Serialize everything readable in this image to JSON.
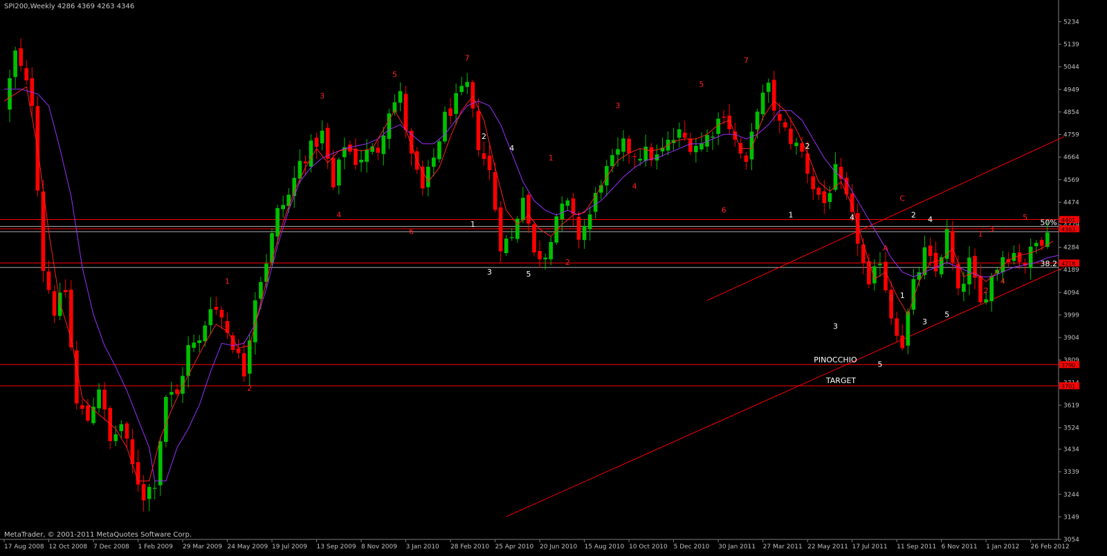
{
  "window": {
    "title": "SPI200,Weekly",
    "ohlc": "4286 4369 4263 4346",
    "copyright": "MetaTrader, © 2001-2011 MetaQuotes Software Corp."
  },
  "colors": {
    "background": "#000000",
    "bull": "#00c000",
    "bear": "#ff0000",
    "ma_fast": "#ff2020",
    "ma_slow": "#9b30ff",
    "level_line": "#ff0000",
    "fib_line": "#b0b0b0",
    "axis_text": "#c0c0c0",
    "wave_red": "#ff2020",
    "wave_white": "#ffffff"
  },
  "chart_data": {
    "type": "candlestick",
    "symbol": "SPI200",
    "timeframe": "Weekly",
    "ylim": [
      3054,
      5273
    ],
    "y_ticks": [
      5234,
      5139,
      5044,
      4949,
      4854,
      4759,
      4664,
      4569,
      4474,
      4379,
      4284,
      4189,
      4094,
      3999,
      3904,
      3809,
      3714,
      3619,
      3524,
      3434,
      3339,
      3244,
      3149,
      3054
    ],
    "x_ticks": [
      {
        "w": 0,
        "label": "17 Aug 2008"
      },
      {
        "w": 8,
        "label": "12 Oct 2008"
      },
      {
        "w": 16,
        "label": "7 Dec 2008"
      },
      {
        "w": 24,
        "label": "1 Feb 2009"
      },
      {
        "w": 32,
        "label": "29 Mar 2009"
      },
      {
        "w": 40,
        "label": "24 May 2009"
      },
      {
        "w": 48,
        "label": "19 Jul 2009"
      },
      {
        "w": 56,
        "label": "13 Sep 2009"
      },
      {
        "w": 64,
        "label": "8 Nov 2009"
      },
      {
        "w": 72,
        "label": "3 Jan 2010"
      },
      {
        "w": 80,
        "label": "28 Feb 2010"
      },
      {
        "w": 88,
        "label": "25 Apr 2010"
      },
      {
        "w": 96,
        "label": "20 Jun 2010"
      },
      {
        "w": 104,
        "label": "15 Aug 2010"
      },
      {
        "w": 112,
        "label": "10 Oct 2010"
      },
      {
        "w": 120,
        "label": "5 Dec 2010"
      },
      {
        "w": 128,
        "label": "30 Jan 2011"
      },
      {
        "w": 136,
        "label": "27 Mar 2011"
      },
      {
        "w": 144,
        "label": "22 May 2011"
      },
      {
        "w": 152,
        "label": "17 Jul 2011"
      },
      {
        "w": 160,
        "label": "11 Sep 2011"
      },
      {
        "w": 168,
        "label": "6 Nov 2011"
      },
      {
        "w": 176,
        "label": "1 Jan 2012"
      },
      {
        "w": 184,
        "label": "26 Feb 2012"
      }
    ],
    "close_path": [
      [
        0,
        4870
      ],
      [
        2,
        5100
      ],
      [
        5,
        4900
      ],
      [
        7,
        4200
      ],
      [
        9,
        4020
      ],
      [
        11,
        4100
      ],
      [
        13,
        3620
      ],
      [
        15,
        3560
      ],
      [
        17,
        3700
      ],
      [
        19,
        3460
      ],
      [
        21,
        3540
      ],
      [
        23,
        3360
      ],
      [
        25,
        3240
      ],
      [
        27,
        3300
      ],
      [
        29,
        3660
      ],
      [
        31,
        3660
      ],
      [
        33,
        3860
      ],
      [
        35,
        3880
      ],
      [
        37,
        4050
      ],
      [
        39,
        3990
      ],
      [
        41,
        3880
      ],
      [
        43,
        3760
      ],
      [
        45,
        4080
      ],
      [
        47,
        4230
      ],
      [
        49,
        4430
      ],
      [
        51,
        4500
      ],
      [
        53,
        4640
      ],
      [
        55,
        4700
      ],
      [
        57,
        4760
      ],
      [
        59,
        4530
      ],
      [
        61,
        4720
      ],
      [
        63,
        4650
      ],
      [
        65,
        4680
      ],
      [
        67,
        4700
      ],
      [
        69,
        4870
      ],
      [
        71,
        4920
      ],
      [
        73,
        4660
      ],
      [
        75,
        4520
      ],
      [
        77,
        4660
      ],
      [
        79,
        4830
      ],
      [
        81,
        4900
      ],
      [
        83,
        4960
      ],
      [
        85,
        4720
      ],
      [
        87,
        4600
      ],
      [
        89,
        4300
      ],
      [
        91,
        4320
      ],
      [
        93,
        4520
      ],
      [
        95,
        4250
      ],
      [
        97,
        4260
      ],
      [
        99,
        4420
      ],
      [
        101,
        4460
      ],
      [
        103,
        4330
      ],
      [
        105,
        4420
      ],
      [
        107,
        4570
      ],
      [
        109,
        4640
      ],
      [
        111,
        4710
      ],
      [
        113,
        4680
      ],
      [
        115,
        4680
      ],
      [
        117,
        4660
      ],
      [
        119,
        4720
      ],
      [
        121,
        4760
      ],
      [
        123,
        4720
      ],
      [
        125,
        4720
      ],
      [
        127,
        4780
      ],
      [
        129,
        4860
      ],
      [
        131,
        4730
      ],
      [
        133,
        4620
      ],
      [
        135,
        4880
      ],
      [
        137,
        4950
      ],
      [
        139,
        4800
      ],
      [
        141,
        4740
      ],
      [
        143,
        4680
      ],
      [
        145,
        4540
      ],
      [
        147,
        4470
      ],
      [
        149,
        4600
      ],
      [
        151,
        4480
      ],
      [
        153,
        4320
      ],
      [
        155,
        4100
      ],
      [
        157,
        4240
      ],
      [
        159,
        4000
      ],
      [
        161,
        3880
      ],
      [
        163,
        4120
      ],
      [
        165,
        4260
      ],
      [
        167,
        4180
      ],
      [
        169,
        4340
      ],
      [
        171,
        4080
      ],
      [
        173,
        4220
      ],
      [
        175,
        4040
      ],
      [
        177,
        4160
      ],
      [
        179,
        4250
      ],
      [
        181,
        4260
      ],
      [
        183,
        4220
      ],
      [
        185,
        4300
      ],
      [
        187,
        4346
      ]
    ],
    "ma_fast": [
      [
        0,
        4900
      ],
      [
        4,
        4960
      ],
      [
        6,
        4700
      ],
      [
        8,
        4350
      ],
      [
        10,
        4050
      ],
      [
        12,
        3900
      ],
      [
        14,
        3650
      ],
      [
        16,
        3600
      ],
      [
        18,
        3560
      ],
      [
        20,
        3520
      ],
      [
        22,
        3440
      ],
      [
        24,
        3300
      ],
      [
        26,
        3300
      ],
      [
        28,
        3480
      ],
      [
        30,
        3600
      ],
      [
        32,
        3700
      ],
      [
        34,
        3790
      ],
      [
        36,
        3880
      ],
      [
        38,
        3960
      ],
      [
        40,
        3930
      ],
      [
        42,
        3860
      ],
      [
        44,
        3870
      ],
      [
        46,
        4050
      ],
      [
        48,
        4230
      ],
      [
        50,
        4390
      ],
      [
        52,
        4520
      ],
      [
        54,
        4620
      ],
      [
        56,
        4700
      ],
      [
        58,
        4640
      ],
      [
        60,
        4690
      ],
      [
        62,
        4700
      ],
      [
        64,
        4690
      ],
      [
        66,
        4700
      ],
      [
        68,
        4780
      ],
      [
        70,
        4860
      ],
      [
        72,
        4780
      ],
      [
        74,
        4650
      ],
      [
        76,
        4560
      ],
      [
        78,
        4620
      ],
      [
        80,
        4750
      ],
      [
        82,
        4860
      ],
      [
        84,
        4920
      ],
      [
        86,
        4820
      ],
      [
        88,
        4620
      ],
      [
        90,
        4440
      ],
      [
        92,
        4380
      ],
      [
        94,
        4420
      ],
      [
        96,
        4360
      ],
      [
        98,
        4330
      ],
      [
        100,
        4380
      ],
      [
        102,
        4420
      ],
      [
        104,
        4430
      ],
      [
        106,
        4500
      ],
      [
        108,
        4580
      ],
      [
        110,
        4650
      ],
      [
        112,
        4680
      ],
      [
        114,
        4700
      ],
      [
        116,
        4690
      ],
      [
        118,
        4700
      ],
      [
        120,
        4730
      ],
      [
        122,
        4740
      ],
      [
        124,
        4740
      ],
      [
        126,
        4760
      ],
      [
        128,
        4800
      ],
      [
        130,
        4820
      ],
      [
        132,
        4700
      ],
      [
        134,
        4700
      ],
      [
        136,
        4830
      ],
      [
        138,
        4900
      ],
      [
        140,
        4860
      ],
      [
        142,
        4780
      ],
      [
        144,
        4680
      ],
      [
        146,
        4560
      ],
      [
        148,
        4520
      ],
      [
        150,
        4560
      ],
      [
        152,
        4460
      ],
      [
        154,
        4300
      ],
      [
        156,
        4150
      ],
      [
        158,
        4180
      ],
      [
        160,
        4080
      ],
      [
        162,
        4000
      ],
      [
        164,
        4140
      ],
      [
        166,
        4220
      ],
      [
        168,
        4230
      ],
      [
        170,
        4280
      ],
      [
        172,
        4160
      ],
      [
        174,
        4180
      ],
      [
        176,
        4140
      ],
      [
        178,
        4180
      ],
      [
        180,
        4230
      ],
      [
        182,
        4250
      ],
      [
        184,
        4260
      ],
      [
        186,
        4280
      ],
      [
        188,
        4310
      ]
    ],
    "ma_slow": [
      [
        0,
        4950
      ],
      [
        3,
        4950
      ],
      [
        6,
        4930
      ],
      [
        8,
        4880
      ],
      [
        10,
        4700
      ],
      [
        12,
        4500
      ],
      [
        14,
        4200
      ],
      [
        16,
        4000
      ],
      [
        18,
        3870
      ],
      [
        20,
        3780
      ],
      [
        22,
        3680
      ],
      [
        24,
        3560
      ],
      [
        26,
        3440
      ],
      [
        27,
        3300
      ],
      [
        29,
        3300
      ],
      [
        31,
        3440
      ],
      [
        33,
        3520
      ],
      [
        35,
        3620
      ],
      [
        37,
        3760
      ],
      [
        39,
        3880
      ],
      [
        41,
        3870
      ],
      [
        43,
        3880
      ],
      [
        45,
        3960
      ],
      [
        47,
        4110
      ],
      [
        49,
        4290
      ],
      [
        51,
        4440
      ],
      [
        53,
        4560
      ],
      [
        55,
        4620
      ],
      [
        57,
        4660
      ],
      [
        59,
        4680
      ],
      [
        61,
        4700
      ],
      [
        63,
        4710
      ],
      [
        65,
        4720
      ],
      [
        67,
        4740
      ],
      [
        69,
        4780
      ],
      [
        71,
        4800
      ],
      [
        73,
        4760
      ],
      [
        75,
        4720
      ],
      [
        77,
        4720
      ],
      [
        79,
        4760
      ],
      [
        81,
        4820
      ],
      [
        83,
        4880
      ],
      [
        85,
        4900
      ],
      [
        87,
        4880
      ],
      [
        89,
        4800
      ],
      [
        91,
        4680
      ],
      [
        93,
        4560
      ],
      [
        95,
        4480
      ],
      [
        97,
        4440
      ],
      [
        99,
        4420
      ],
      [
        101,
        4440
      ],
      [
        103,
        4420
      ],
      [
        105,
        4450
      ],
      [
        107,
        4480
      ],
      [
        109,
        4530
      ],
      [
        111,
        4580
      ],
      [
        113,
        4620
      ],
      [
        115,
        4650
      ],
      [
        117,
        4660
      ],
      [
        119,
        4680
      ],
      [
        121,
        4700
      ],
      [
        123,
        4720
      ],
      [
        125,
        4720
      ],
      [
        127,
        4740
      ],
      [
        129,
        4760
      ],
      [
        131,
        4760
      ],
      [
        133,
        4740
      ],
      [
        135,
        4760
      ],
      [
        137,
        4800
      ],
      [
        139,
        4860
      ],
      [
        141,
        4860
      ],
      [
        143,
        4820
      ],
      [
        145,
        4740
      ],
      [
        147,
        4660
      ],
      [
        149,
        4600
      ],
      [
        151,
        4560
      ],
      [
        153,
        4480
      ],
      [
        155,
        4400
      ],
      [
        157,
        4320
      ],
      [
        159,
        4240
      ],
      [
        161,
        4180
      ],
      [
        163,
        4160
      ],
      [
        165,
        4180
      ],
      [
        167,
        4200
      ],
      [
        169,
        4220
      ],
      [
        171,
        4200
      ],
      [
        173,
        4180
      ],
      [
        175,
        4160
      ],
      [
        177,
        4160
      ],
      [
        179,
        4180
      ],
      [
        181,
        4200
      ],
      [
        183,
        4210
      ],
      [
        185,
        4220
      ],
      [
        187,
        4240
      ],
      [
        189,
        4250
      ]
    ],
    "horizontal_levels": [
      {
        "price": 4401,
        "label": "4401"
      },
      {
        "price": 4362,
        "label": "4363"
      },
      {
        "price": 4218,
        "label": "4218"
      },
      {
        "price": 3790,
        "label": "3790"
      },
      {
        "price": 3701,
        "label": "3701"
      }
    ],
    "fib_levels": [
      {
        "price": 4372,
        "label": "50%"
      },
      {
        "price": 4350,
        "label": ""
      },
      {
        "price": 4199,
        "label": "38.2"
      }
    ],
    "trendlines": [
      {
        "from": [
          90,
          3150
        ],
        "to": [
          190,
          4200
        ]
      },
      {
        "from": [
          126,
          4060
        ],
        "to": [
          190,
          4750
        ]
      }
    ],
    "text_labels": [
      {
        "text": "PINOCCHIO",
        "w": 149,
        "price": 3800
      },
      {
        "text": "TARGET",
        "w": 150,
        "price": 3712
      }
    ],
    "wave_labels": [
      {
        "t": "1",
        "w": 40,
        "p": 4130,
        "c": "red"
      },
      {
        "t": "2",
        "w": 44,
        "p": 3680,
        "c": "red"
      },
      {
        "t": "3",
        "w": 57,
        "p": 4910,
        "c": "red"
      },
      {
        "t": "4",
        "w": 60,
        "p": 4410,
        "c": "red"
      },
      {
        "t": "5",
        "w": 70,
        "p": 5000,
        "c": "red"
      },
      {
        "t": "6",
        "w": 73,
        "p": 4340,
        "c": "red"
      },
      {
        "t": "7",
        "w": 83,
        "p": 5070,
        "c": "red"
      },
      {
        "t": "1",
        "w": 84,
        "p": 4370,
        "c": "white"
      },
      {
        "t": "2",
        "w": 86,
        "p": 4740,
        "c": "white"
      },
      {
        "t": "3",
        "w": 87,
        "p": 4170,
        "c": "white"
      },
      {
        "t": "4",
        "w": 91,
        "p": 4690,
        "c": "white"
      },
      {
        "t": "5",
        "w": 94,
        "p": 4160,
        "c": "white"
      },
      {
        "t": "1",
        "w": 98,
        "p": 4650,
        "c": "red"
      },
      {
        "t": "2",
        "w": 101,
        "p": 4210,
        "c": "red"
      },
      {
        "t": "3",
        "w": 110,
        "p": 4870,
        "c": "red"
      },
      {
        "t": "4",
        "w": 113,
        "p": 4530,
        "c": "red"
      },
      {
        "t": "5",
        "w": 125,
        "p": 4960,
        "c": "red"
      },
      {
        "t": "6",
        "w": 129,
        "p": 4430,
        "c": "red"
      },
      {
        "t": "7",
        "w": 133,
        "p": 5060,
        "c": "red"
      },
      {
        "t": "2",
        "w": 144,
        "p": 4700,
        "c": "white"
      },
      {
        "t": "1",
        "w": 141,
        "p": 4410,
        "c": "white"
      },
      {
        "t": "4",
        "w": 152,
        "p": 4400,
        "c": "white"
      },
      {
        "t": "3",
        "w": 149,
        "p": 3940,
        "c": "white"
      },
      {
        "t": "5",
        "w": 157,
        "p": 3780,
        "c": "white"
      },
      {
        "t": "A",
        "w": 158,
        "p": 4270,
        "c": "red"
      },
      {
        "t": "B",
        "w": 159,
        "p": 4060,
        "c": "red"
      },
      {
        "t": "C",
        "w": 161,
        "p": 4480,
        "c": "red"
      },
      {
        "t": "1",
        "w": 161,
        "p": 4070,
        "c": "white"
      },
      {
        "t": "2",
        "w": 163,
        "p": 4410,
        "c": "white"
      },
      {
        "t": "3",
        "w": 165,
        "p": 3960,
        "c": "white"
      },
      {
        "t": "4",
        "w": 166,
        "p": 4390,
        "c": "white"
      },
      {
        "t": "5",
        "w": 169,
        "p": 3990,
        "c": "white"
      },
      {
        "t": "1",
        "w": 175,
        "p": 4330,
        "c": "red"
      },
      {
        "t": "2",
        "w": 176,
        "p": 4090,
        "c": "red"
      },
      {
        "t": "3",
        "w": 177,
        "p": 4350,
        "c": "red"
      },
      {
        "t": "4",
        "w": 179,
        "p": 4130,
        "c": "red"
      },
      {
        "t": "5",
        "w": 183,
        "p": 4400,
        "c": "red"
      }
    ]
  }
}
